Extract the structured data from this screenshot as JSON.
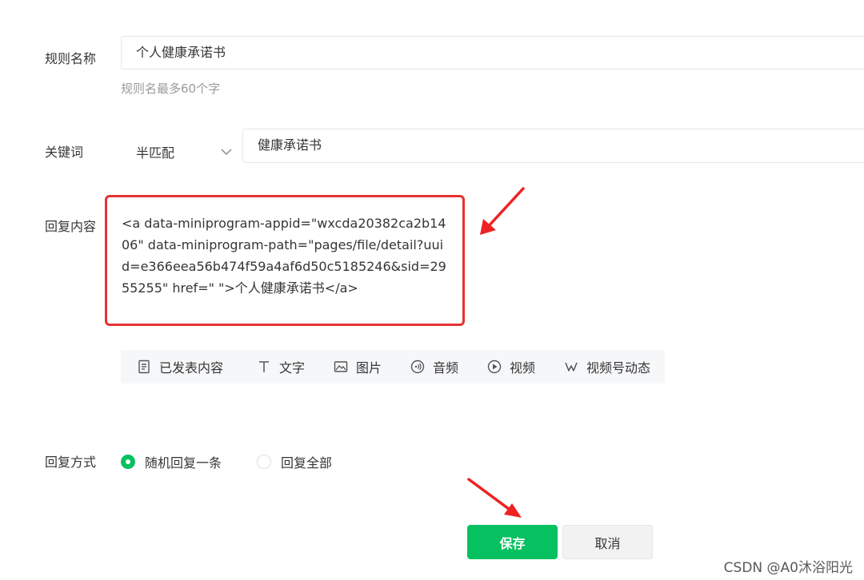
{
  "form": {
    "rule_name": {
      "label": "规则名称",
      "value": "个人健康承诺书",
      "hint": "规则名最多60个字"
    },
    "keyword": {
      "label": "关键词",
      "match_mode": "半匹配",
      "value": "健康承诺书"
    },
    "reply_content": {
      "label": "回复内容",
      "text": "<a data-miniprogram-appid=\"wxcda20382ca2b1406\" data-miniprogram-path=\"pages/file/detail?uuid=e366eea56b474f59a4af6d50c5185246&sid=2955255\" href=\" \">个人健康承诺书</a>"
    },
    "toolbar": {
      "published": "已发表内容",
      "text": "文字",
      "image": "图片",
      "audio": "音频",
      "video": "视频",
      "channels": "视频号动态"
    },
    "reply_mode": {
      "label": "回复方式",
      "options": [
        {
          "label": "随机回复一条",
          "selected": true
        },
        {
          "label": "回复全部",
          "selected": false
        }
      ]
    },
    "actions": {
      "save": "保存",
      "cancel": "取消"
    }
  },
  "watermark": "CSDN @A0沐浴阳光",
  "colors": {
    "primary": "#07c160",
    "highlight": "#e63232"
  }
}
